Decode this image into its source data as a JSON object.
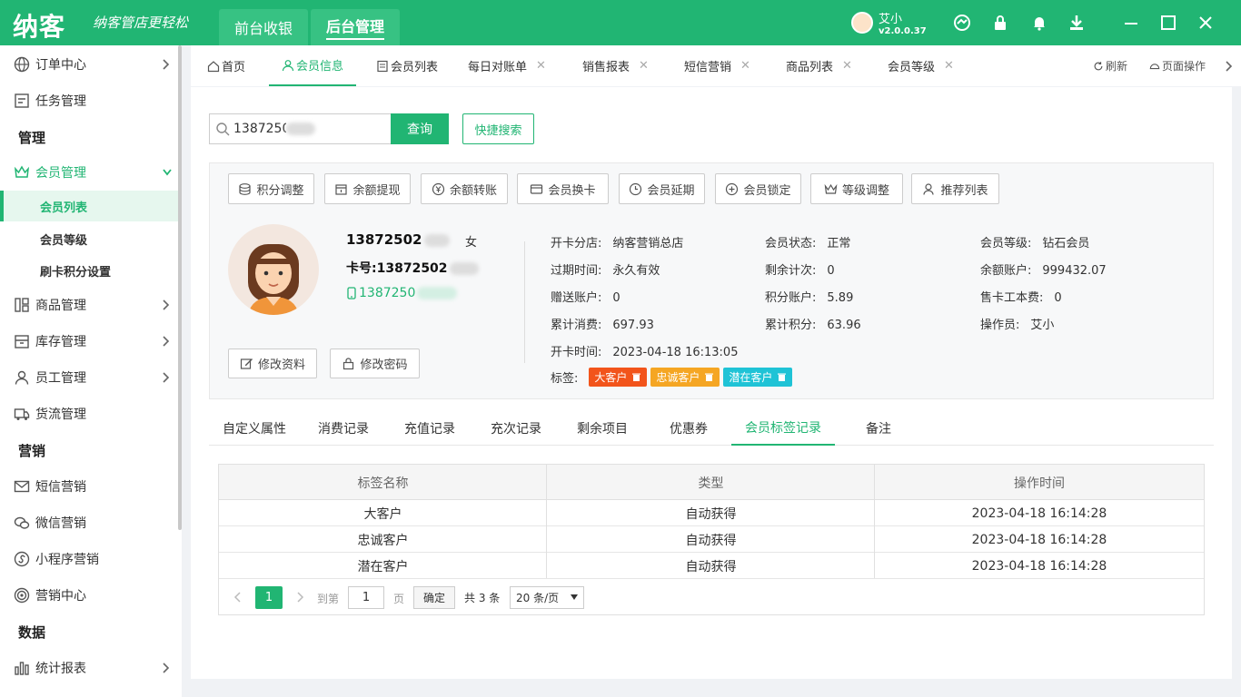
{
  "brand": {
    "logo": "纳客",
    "slogan": "纳客管店更轻松"
  },
  "top_tabs": [
    {
      "label": "前台收银"
    },
    {
      "label": "后台管理"
    }
  ],
  "user": {
    "name": "艾小",
    "version": "v2.0.0.37"
  },
  "sidebar": {
    "items": [
      {
        "label": "订单中心"
      },
      {
        "label": "任务管理"
      },
      {
        "label": "会员管理"
      },
      {
        "label": "商品管理"
      },
      {
        "label": "库存管理"
      },
      {
        "label": "员工管理"
      },
      {
        "label": "货流管理"
      },
      {
        "label": "短信营销"
      },
      {
        "label": "微信营销"
      },
      {
        "label": "小程序营销"
      },
      {
        "label": "营销中心"
      },
      {
        "label": "统计报表"
      }
    ],
    "sections": [
      "管理",
      "营销",
      "数据"
    ],
    "sub_items": [
      {
        "label": "会员列表"
      },
      {
        "label": "会员等级"
      },
      {
        "label": "刷卡积分设置"
      }
    ]
  },
  "page_tabs": [
    {
      "label": "首页"
    },
    {
      "label": "会员信息"
    },
    {
      "label": "会员列表"
    },
    {
      "label": "每日对账单"
    },
    {
      "label": "销售报表"
    },
    {
      "label": "短信营销"
    },
    {
      "label": "商品列表"
    },
    {
      "label": "会员等级"
    }
  ],
  "tab_actions": {
    "refresh": "刷新",
    "page_ops": "页面操作"
  },
  "search": {
    "value": "1387250",
    "button": "查询",
    "quick": "快捷搜索"
  },
  "actions": [
    "积分调整",
    "余额提现",
    "余额转账",
    "会员换卡",
    "会员延期",
    "会员锁定",
    "等级调整",
    "推荐列表"
  ],
  "member": {
    "phone": "13872502",
    "gender": "女",
    "card_label": "卡号:",
    "card": "13872502",
    "mobile": "1387250",
    "edit_profile": "修改资料",
    "edit_password": "修改密码"
  },
  "info": {
    "col1": [
      {
        "k": "开卡分店:",
        "v": "纳客营销总店"
      },
      {
        "k": "过期时间:",
        "v": "永久有效"
      },
      {
        "k": "赠送账户:",
        "v": "0"
      },
      {
        "k": "累计消费:",
        "v": "697.93"
      },
      {
        "k": "开卡时间:",
        "v": "2023-04-18 16:13:05"
      }
    ],
    "col2": [
      {
        "k": "会员状态:",
        "v": "正常"
      },
      {
        "k": "剩余计次:",
        "v": "0"
      },
      {
        "k": "积分账户:",
        "v": "5.89"
      },
      {
        "k": "累计积分:",
        "v": "63.96"
      }
    ],
    "col3": [
      {
        "k": "会员等级:",
        "v": "钻石会员"
      },
      {
        "k": "余额账户:",
        "v": "999432.07"
      },
      {
        "k": "售卡工本费:",
        "v": "0"
      },
      {
        "k": "操作员:",
        "v": "艾小"
      }
    ],
    "tags_label": "标签:",
    "tags": [
      {
        "label": "大客户",
        "color": "#f2541b"
      },
      {
        "label": "忠诚客户",
        "color": "#f5a623"
      },
      {
        "label": "潜在客户",
        "color": "#1fc3d6"
      }
    ]
  },
  "sub_tabs": [
    "自定义属性",
    "消费记录",
    "充值记录",
    "充次记录",
    "剩余项目",
    "优惠券",
    "会员标签记录",
    "备注"
  ],
  "table": {
    "columns": [
      "标签名称",
      "类型",
      "操作时间"
    ],
    "rows": [
      [
        "大客户",
        "自动获得",
        "2023-04-18 16:14:28"
      ],
      [
        "忠诚客户",
        "自动获得",
        "2023-04-18 16:14:28"
      ],
      [
        "潜在客户",
        "自动获得",
        "2023-04-18 16:14:28"
      ]
    ]
  },
  "pager": {
    "current": "1",
    "goto_label": "到第",
    "goto_value": "1",
    "page_unit": "页",
    "ok": "确定",
    "total": "共 3 条",
    "page_size": "20 条/页"
  },
  "colors": {
    "primary": "#21b573"
  }
}
